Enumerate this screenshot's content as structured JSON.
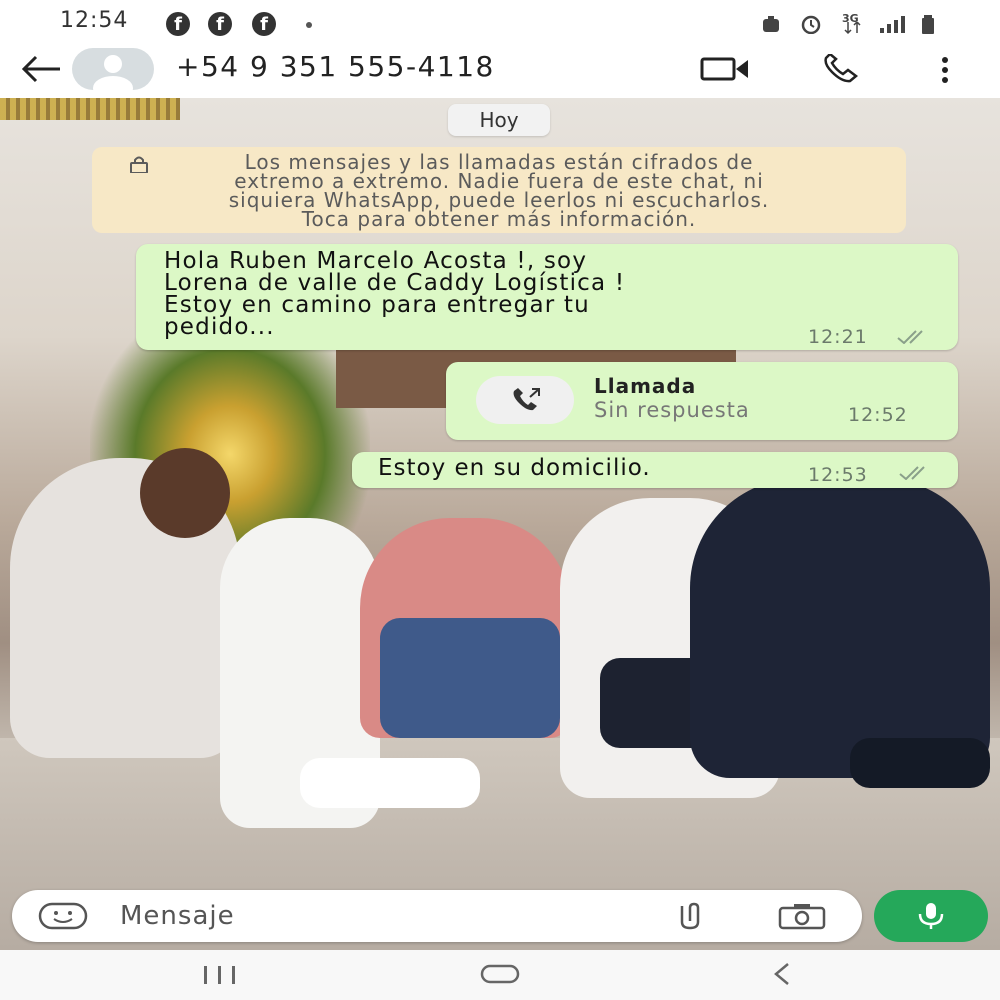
{
  "status_bar": {
    "time": "12:54",
    "notification_icons": [
      "facebook-icon",
      "facebook-icon",
      "facebook-icon"
    ],
    "network": "3G"
  },
  "header": {
    "contact": "+54 9 351 555-4118",
    "icons": [
      "back-arrow-icon",
      "avatar-icon",
      "video-call-icon",
      "phone-icon",
      "more-vert-icon"
    ]
  },
  "chat": {
    "date_chip": "Hoy",
    "encryption_notice": "Los mensajes y las llamadas están cifrados de\nextremo a extremo. Nadie fuera de este chat, ni\nsiquiera WhatsApp, puede leerlos ni escucharlos.\nToca para obtener más información.",
    "messages": [
      {
        "type": "text",
        "text": "Hola Ruben Marcelo Acosta  !, soy\nLorena de valle de Caddy Logística !\nEstoy en camino para entregar tu\npedido...",
        "time": "12:21",
        "status": "read-double-check"
      },
      {
        "type": "call",
        "title": "Llamada",
        "subtitle": "Sin respuesta",
        "time": "12:52"
      },
      {
        "type": "text",
        "text": "Estoy en su domicilio.",
        "time": "12:53",
        "status": "read-double-check"
      }
    ]
  },
  "input": {
    "placeholder": "Mensaje",
    "icons": [
      "emoji-sticker-icon",
      "attach-icon",
      "camera-icon",
      "mic-icon"
    ]
  },
  "colors": {
    "bubble_out": "#dcf8c6",
    "notice_bg": "#f7e8c6",
    "accent_green": "#25a85a"
  }
}
